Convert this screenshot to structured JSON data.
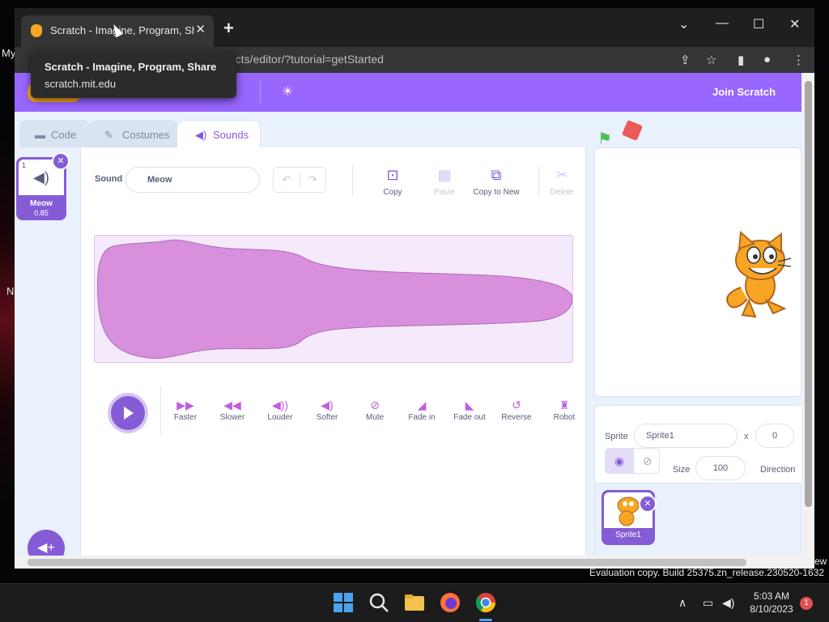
{
  "desktop": {
    "frag_my": "My",
    "frag_n": "N",
    "frag_ew": "ew",
    "eval_text": "Evaluation copy. Build 25375.zn_release.230520-1632"
  },
  "browser": {
    "tab_title": "Scratch - Imagine, Program, Share",
    "tab_close": "✕",
    "new_tab": "+",
    "url": "ojects/editor/?tutorial=getStarted",
    "tooltip": {
      "title": "Scratch - Imagine, Program, Share",
      "domain": "scratch.mit.edu"
    },
    "controls": {
      "dropdown": "⌄",
      "minimize": "—",
      "maximize": "☐",
      "close": "✕"
    }
  },
  "scratch": {
    "logo": "Scratch",
    "join": "Join Scratch",
    "tabs": [
      "Code",
      "Costumes",
      "Sounds"
    ],
    "active_tab": "Sounds",
    "sound_list": [
      {
        "index": "1",
        "name": "Meow",
        "duration": "0.85"
      }
    ],
    "editor": {
      "sound_label": "Sound",
      "sound_name": "Meow",
      "tools": [
        "Copy",
        "Paste",
        "Copy to New",
        "Delete"
      ],
      "effects": [
        "Faster",
        "Slower",
        "Louder",
        "Softer",
        "Mute",
        "Fade in",
        "Fade out",
        "Reverse",
        "Robot"
      ]
    },
    "sprite_pane": {
      "sprite_label": "Sprite",
      "sprite_name": "Sprite1",
      "x_label": "x",
      "x_value": "0",
      "size_label": "Size",
      "size_value": "100",
      "direction_label": "Direction",
      "sprites": [
        {
          "name": "Sprite1"
        }
      ]
    }
  },
  "taskbar": {
    "time": "5:03 AM",
    "date": "8/10/2023",
    "notifications": "1"
  },
  "colors": {
    "scratch_purple": "#9966ff",
    "accent": "#855cd6",
    "waveform": "#d88fdc",
    "flag": "#4cbf56",
    "stop": "#ec5959"
  }
}
